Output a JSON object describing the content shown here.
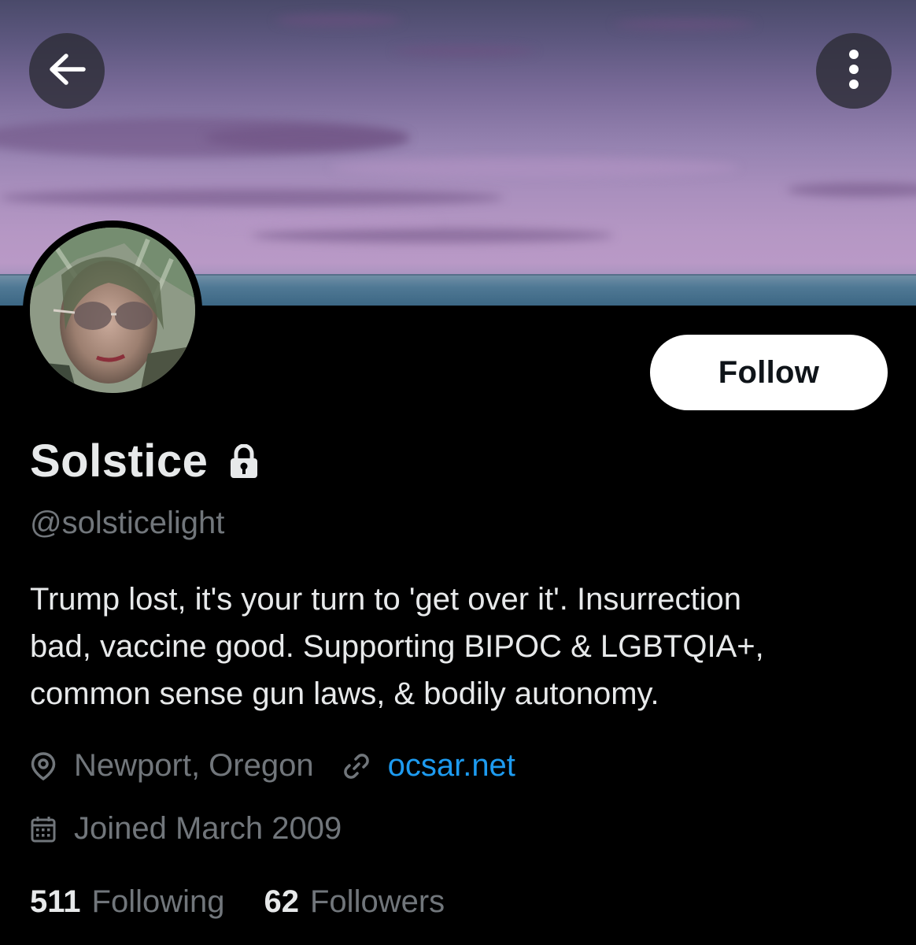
{
  "header": {
    "back_icon": "arrow-left-icon",
    "more_icon": "more-vertical-icon"
  },
  "profile": {
    "follow_label": "Follow",
    "display_name": "Solstice",
    "protected_icon": "lock-icon",
    "handle": "@solsticelight",
    "bio": "Trump lost, it's your turn to 'get over it'. Insurrection\nbad, vaccine good. Supporting BIPOC & LGBTQIA+,\ncommon sense gun laws, & bodily autonomy.",
    "location": "Newport, Oregon",
    "website": "ocsar.net",
    "joined": "Joined March 2009",
    "following_count": "511",
    "following_label": "Following",
    "followers_count": "62",
    "followers_label": "Followers"
  },
  "colors": {
    "background": "#000000",
    "text_primary": "#e7e9ea",
    "text_secondary": "#71767b",
    "link": "#1d9bf0",
    "button_bg": "#ffffff"
  }
}
